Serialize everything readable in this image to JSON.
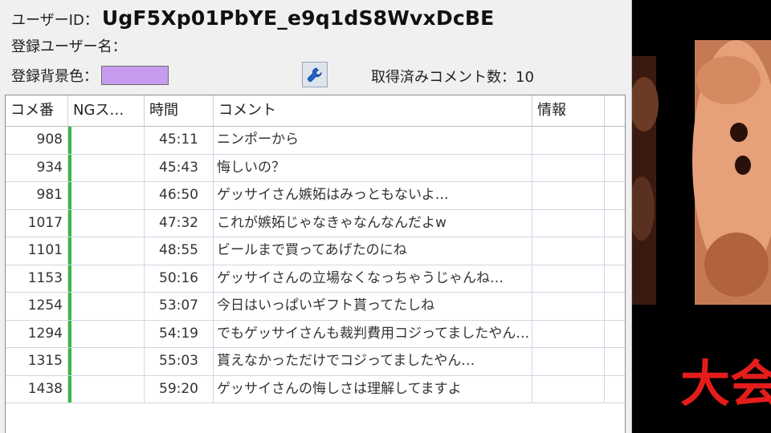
{
  "user": {
    "id_label": "ユーザーID：",
    "id_value": "UgF5Xp01PbYE_e9q1dS8WvxDcBE",
    "name_label": "登録ユーザー名：",
    "name_value": "",
    "color_label": "登録背景色：",
    "color_value": "#c79cf0"
  },
  "toolbar": {
    "tool_icon": "wrench-icon"
  },
  "stats": {
    "count_label": "取得済みコメント数：",
    "count_value": "10"
  },
  "table": {
    "columns": [
      "コメ番",
      "NGス…",
      "時間",
      "コメント",
      "情報"
    ],
    "ng_color": "#3cb843",
    "rows": [
      {
        "num": "908",
        "time": "45:11",
        "comment": "ニンポーから",
        "info": ""
      },
      {
        "num": "934",
        "time": "45:43",
        "comment": "悔しいの？",
        "info": ""
      },
      {
        "num": "981",
        "time": "46:50",
        "comment": "ゲッサイさん嫉妬はみっともないよ…",
        "info": ""
      },
      {
        "num": "1017",
        "time": "47:32",
        "comment": "これが嫉妬じゃなきゃなんなんだよw",
        "info": ""
      },
      {
        "num": "1101",
        "time": "48:55",
        "comment": "ビールまで買ってあげたのにね",
        "info": ""
      },
      {
        "num": "1153",
        "time": "50:16",
        "comment": "ゲッサイさんの立場なくなっちゃうじゃんね…",
        "info": ""
      },
      {
        "num": "1254",
        "time": "53:07",
        "comment": "今日はいっぱいギフト貰ってたしね",
        "info": ""
      },
      {
        "num": "1294",
        "time": "54:19",
        "comment": "でもゲッサイさんも裁判費用コジってましたやん…",
        "info": ""
      },
      {
        "num": "1315",
        "time": "55:03",
        "comment": "貰えなかっただけでコジってましたやん…",
        "info": ""
      },
      {
        "num": "1438",
        "time": "59:20",
        "comment": "ゲッサイさんの悔しさは理解してますよ",
        "info": ""
      }
    ]
  },
  "video": {
    "caption_visible": "大会"
  }
}
